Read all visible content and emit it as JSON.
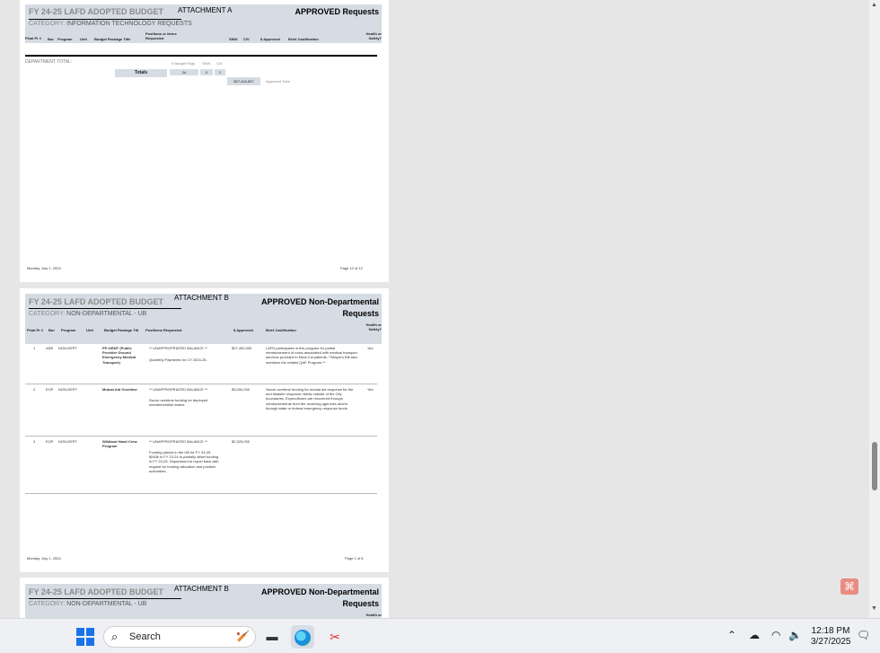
{
  "page1": {
    "title": "FY 24-25 LAFD ADOPTED BUDGET",
    "attachment": "ATTACHMENT A",
    "approved": "APPROVED Requests",
    "category_label": "CATEGORY:",
    "category": "INFORMATION TECHNOLOGY REQUESTS",
    "columns": [
      "Final Pr #",
      "Bur",
      "Program",
      "Unit",
      "Budget Package Title",
      "Positions or Items Requested",
      "SWN",
      "CIV",
      "$ Approved",
      "Brief Justification",
      "Health or Safety?"
    ],
    "dept_total_label": "DEPARTMENT TOTAL:",
    "sub_headers": [
      "# Budget Pkgs",
      "SWN",
      "CIV"
    ],
    "totals_label": "Totals",
    "totals_values": [
      "24",
      "0",
      "1"
    ],
    "approved_total_value": "$27,446,837",
    "approved_total_label": "Approved Total",
    "footer_date": "Monday, July 1, 2024",
    "footer_page": "Page 12 of 12"
  },
  "page2": {
    "title": "FY 24-25 LAFD ADOPTED BUDGET",
    "attachment": "ATTACHMENT B",
    "approved_line1": "APPROVED Non-Departmental",
    "approved_line2": "Requests",
    "category_label": "CATEGORY:",
    "category": "NON-DEPARTMENTAL - UB",
    "columns": [
      "Final Pr #",
      "Bur",
      "Program",
      "Unit",
      "Budget Package Titl",
      "Pos/Items Requested",
      "$ Approved",
      "Brief Justification",
      "Health or Safety?"
    ],
    "rows": [
      {
        "num": "1",
        "bur": "ASB",
        "program": "NON-DEPT",
        "title": "PP-GEMT (Public Provider Ground Emergency Medical Transport)",
        "items1": "** UNAPPROPRIATED BALANCE **",
        "items2": "Quarterly Payments for CY 2024-25.",
        "amount": "$27,450,000",
        "justification": "LAFD participates in this program for partial reimbursement of costs associated with medical transport services provided to Medi-Cal patients. **Mayor's Bill also mentions the related QAF Program.**",
        "health": "Yes"
      },
      {
        "num": "2",
        "bur": "EOP",
        "program": "NON-DEPT",
        "title": "Mutual Aid Overtime",
        "items1": "** UNAPPROPRIATED BALANCE **",
        "items2": "Sworn overtime funding for deployed members/strike teams",
        "amount": "$3,000,000",
        "justification": "Sworn overtime funding for mutual aid response for fire and disaster response needs outside of the City boundaries. Expenditures are recovered through reimbursements from the receiving agencies and/or through state or federal emergency response funds",
        "health": "Yes"
      },
      {
        "num": "3",
        "bur": "EOP",
        "program": "NON-DEPT",
        "title": "Wildland Hand Crew Program",
        "items1": "** UNAPPROPRIATED BALANCE **",
        "items2": "Funding placed in the UB for FY 24-25. $943k in FY 23-24 to partially offset funding in FY 24-25. Department to report back with request for funding allocation and position authorities.",
        "amount": "$2,325,000",
        "justification": "",
        "health": ""
      }
    ],
    "footer_date": "Monday, July 1, 2024",
    "footer_page": "Page 1 of 6"
  },
  "page3": {
    "title": "FY 24-25 LAFD ADOPTED BUDGET",
    "attachment": "ATTACHMENT B",
    "approved_line1": "APPROVED Non-Departmental",
    "approved_line2": "Requests",
    "category_label": "CATEGORY:",
    "category": "NON-DEPARTMENTAL - UB",
    "health_col": "Health or"
  },
  "taskbar": {
    "search_placeholder": "Search",
    "time": "12:18 PM",
    "date": "3/27/2025",
    "icons": [
      "windows-start-icon",
      "search-icon",
      "task-view-icon",
      "edge-browser-icon",
      "snipping-tool-icon",
      "chevron-up-icon",
      "onedrive-cloud-icon",
      "wifi-icon",
      "volume-icon",
      "notification-icon"
    ]
  },
  "colors": {
    "header_band": "#d6dce4",
    "title_grey": "#8a8a8a",
    "pdf_accent": "#e88c84"
  }
}
